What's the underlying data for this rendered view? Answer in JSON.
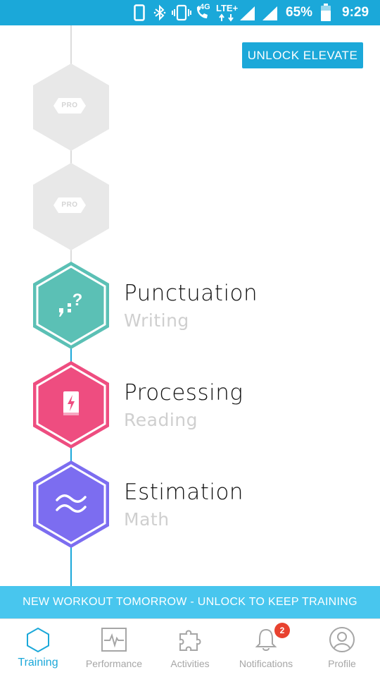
{
  "status_bar": {
    "battery_percent": "65%",
    "time": "9:29",
    "network_4g": "4G",
    "network_lte": "LTE+",
    "background": "#1ba8d9",
    "icons": [
      "phone-icon",
      "bluetooth-icon",
      "vibrate-icon",
      "call-icon",
      "signal-icon",
      "signal-icon",
      "battery-icon"
    ]
  },
  "header": {
    "unlock_button": "UNLOCK ELEVATE"
  },
  "track": {
    "locked_badge": "PRO",
    "locked_items": [
      {
        "badge": "PRO"
      },
      {
        "badge": "PRO"
      }
    ],
    "skills": [
      {
        "title": "Punctuation",
        "category": "Writing",
        "color": "#5bc0b5",
        "icon": "punctuation-icon"
      },
      {
        "title": "Processing",
        "category": "Reading",
        "color": "#ee4d80",
        "icon": "book-bolt-icon"
      },
      {
        "title": "Estimation",
        "category": "Math",
        "color": "#7c6df0",
        "icon": "approx-icon"
      }
    ]
  },
  "banner": {
    "text": "NEW WORKOUT TOMORROW - UNLOCK TO KEEP TRAINING"
  },
  "bottom_nav": {
    "items": [
      {
        "label": "Training",
        "icon": "hexagon-icon",
        "active": true
      },
      {
        "label": "Performance",
        "icon": "pulse-chart-icon",
        "active": false
      },
      {
        "label": "Activities",
        "icon": "puzzle-icon",
        "active": false
      },
      {
        "label": "Notifications",
        "icon": "bell-icon",
        "active": false,
        "badge": "2"
      },
      {
        "label": "Profile",
        "icon": "profile-icon",
        "active": false
      }
    ]
  },
  "colors": {
    "accent": "#1ba8d9",
    "banner": "#48c6ee",
    "badge": "#e8422f",
    "locked": "#e6e6e6"
  }
}
